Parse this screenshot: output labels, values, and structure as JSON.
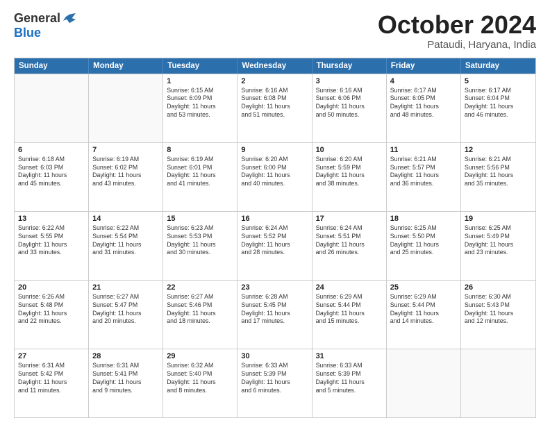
{
  "logo": {
    "general": "General",
    "blue": "Blue"
  },
  "title": "October 2024",
  "location": "Pataudi, Haryana, India",
  "header_days": [
    "Sunday",
    "Monday",
    "Tuesday",
    "Wednesday",
    "Thursday",
    "Friday",
    "Saturday"
  ],
  "weeks": [
    [
      {
        "day": "",
        "lines": [],
        "empty": true
      },
      {
        "day": "",
        "lines": [],
        "empty": true
      },
      {
        "day": "1",
        "lines": [
          "Sunrise: 6:15 AM",
          "Sunset: 6:09 PM",
          "Daylight: 11 hours",
          "and 53 minutes."
        ]
      },
      {
        "day": "2",
        "lines": [
          "Sunrise: 6:16 AM",
          "Sunset: 6:08 PM",
          "Daylight: 11 hours",
          "and 51 minutes."
        ]
      },
      {
        "day": "3",
        "lines": [
          "Sunrise: 6:16 AM",
          "Sunset: 6:06 PM",
          "Daylight: 11 hours",
          "and 50 minutes."
        ]
      },
      {
        "day": "4",
        "lines": [
          "Sunrise: 6:17 AM",
          "Sunset: 6:05 PM",
          "Daylight: 11 hours",
          "and 48 minutes."
        ]
      },
      {
        "day": "5",
        "lines": [
          "Sunrise: 6:17 AM",
          "Sunset: 6:04 PM",
          "Daylight: 11 hours",
          "and 46 minutes."
        ]
      }
    ],
    [
      {
        "day": "6",
        "lines": [
          "Sunrise: 6:18 AM",
          "Sunset: 6:03 PM",
          "Daylight: 11 hours",
          "and 45 minutes."
        ]
      },
      {
        "day": "7",
        "lines": [
          "Sunrise: 6:19 AM",
          "Sunset: 6:02 PM",
          "Daylight: 11 hours",
          "and 43 minutes."
        ]
      },
      {
        "day": "8",
        "lines": [
          "Sunrise: 6:19 AM",
          "Sunset: 6:01 PM",
          "Daylight: 11 hours",
          "and 41 minutes."
        ]
      },
      {
        "day": "9",
        "lines": [
          "Sunrise: 6:20 AM",
          "Sunset: 6:00 PM",
          "Daylight: 11 hours",
          "and 40 minutes."
        ]
      },
      {
        "day": "10",
        "lines": [
          "Sunrise: 6:20 AM",
          "Sunset: 5:59 PM",
          "Daylight: 11 hours",
          "and 38 minutes."
        ]
      },
      {
        "day": "11",
        "lines": [
          "Sunrise: 6:21 AM",
          "Sunset: 5:57 PM",
          "Daylight: 11 hours",
          "and 36 minutes."
        ]
      },
      {
        "day": "12",
        "lines": [
          "Sunrise: 6:21 AM",
          "Sunset: 5:56 PM",
          "Daylight: 11 hours",
          "and 35 minutes."
        ]
      }
    ],
    [
      {
        "day": "13",
        "lines": [
          "Sunrise: 6:22 AM",
          "Sunset: 5:55 PM",
          "Daylight: 11 hours",
          "and 33 minutes."
        ]
      },
      {
        "day": "14",
        "lines": [
          "Sunrise: 6:22 AM",
          "Sunset: 5:54 PM",
          "Daylight: 11 hours",
          "and 31 minutes."
        ]
      },
      {
        "day": "15",
        "lines": [
          "Sunrise: 6:23 AM",
          "Sunset: 5:53 PM",
          "Daylight: 11 hours",
          "and 30 minutes."
        ]
      },
      {
        "day": "16",
        "lines": [
          "Sunrise: 6:24 AM",
          "Sunset: 5:52 PM",
          "Daylight: 11 hours",
          "and 28 minutes."
        ]
      },
      {
        "day": "17",
        "lines": [
          "Sunrise: 6:24 AM",
          "Sunset: 5:51 PM",
          "Daylight: 11 hours",
          "and 26 minutes."
        ]
      },
      {
        "day": "18",
        "lines": [
          "Sunrise: 6:25 AM",
          "Sunset: 5:50 PM",
          "Daylight: 11 hours",
          "and 25 minutes."
        ]
      },
      {
        "day": "19",
        "lines": [
          "Sunrise: 6:25 AM",
          "Sunset: 5:49 PM",
          "Daylight: 11 hours",
          "and 23 minutes."
        ]
      }
    ],
    [
      {
        "day": "20",
        "lines": [
          "Sunrise: 6:26 AM",
          "Sunset: 5:48 PM",
          "Daylight: 11 hours",
          "and 22 minutes."
        ]
      },
      {
        "day": "21",
        "lines": [
          "Sunrise: 6:27 AM",
          "Sunset: 5:47 PM",
          "Daylight: 11 hours",
          "and 20 minutes."
        ]
      },
      {
        "day": "22",
        "lines": [
          "Sunrise: 6:27 AM",
          "Sunset: 5:46 PM",
          "Daylight: 11 hours",
          "and 18 minutes."
        ]
      },
      {
        "day": "23",
        "lines": [
          "Sunrise: 6:28 AM",
          "Sunset: 5:45 PM",
          "Daylight: 11 hours",
          "and 17 minutes."
        ]
      },
      {
        "day": "24",
        "lines": [
          "Sunrise: 6:29 AM",
          "Sunset: 5:44 PM",
          "Daylight: 11 hours",
          "and 15 minutes."
        ]
      },
      {
        "day": "25",
        "lines": [
          "Sunrise: 6:29 AM",
          "Sunset: 5:44 PM",
          "Daylight: 11 hours",
          "and 14 minutes."
        ]
      },
      {
        "day": "26",
        "lines": [
          "Sunrise: 6:30 AM",
          "Sunset: 5:43 PM",
          "Daylight: 11 hours",
          "and 12 minutes."
        ]
      }
    ],
    [
      {
        "day": "27",
        "lines": [
          "Sunrise: 6:31 AM",
          "Sunset: 5:42 PM",
          "Daylight: 11 hours",
          "and 11 minutes."
        ]
      },
      {
        "day": "28",
        "lines": [
          "Sunrise: 6:31 AM",
          "Sunset: 5:41 PM",
          "Daylight: 11 hours",
          "and 9 minutes."
        ]
      },
      {
        "day": "29",
        "lines": [
          "Sunrise: 6:32 AM",
          "Sunset: 5:40 PM",
          "Daylight: 11 hours",
          "and 8 minutes."
        ]
      },
      {
        "day": "30",
        "lines": [
          "Sunrise: 6:33 AM",
          "Sunset: 5:39 PM",
          "Daylight: 11 hours",
          "and 6 minutes."
        ]
      },
      {
        "day": "31",
        "lines": [
          "Sunrise: 6:33 AM",
          "Sunset: 5:39 PM",
          "Daylight: 11 hours",
          "and 5 minutes."
        ]
      },
      {
        "day": "",
        "lines": [],
        "empty": true
      },
      {
        "day": "",
        "lines": [],
        "empty": true
      }
    ]
  ]
}
